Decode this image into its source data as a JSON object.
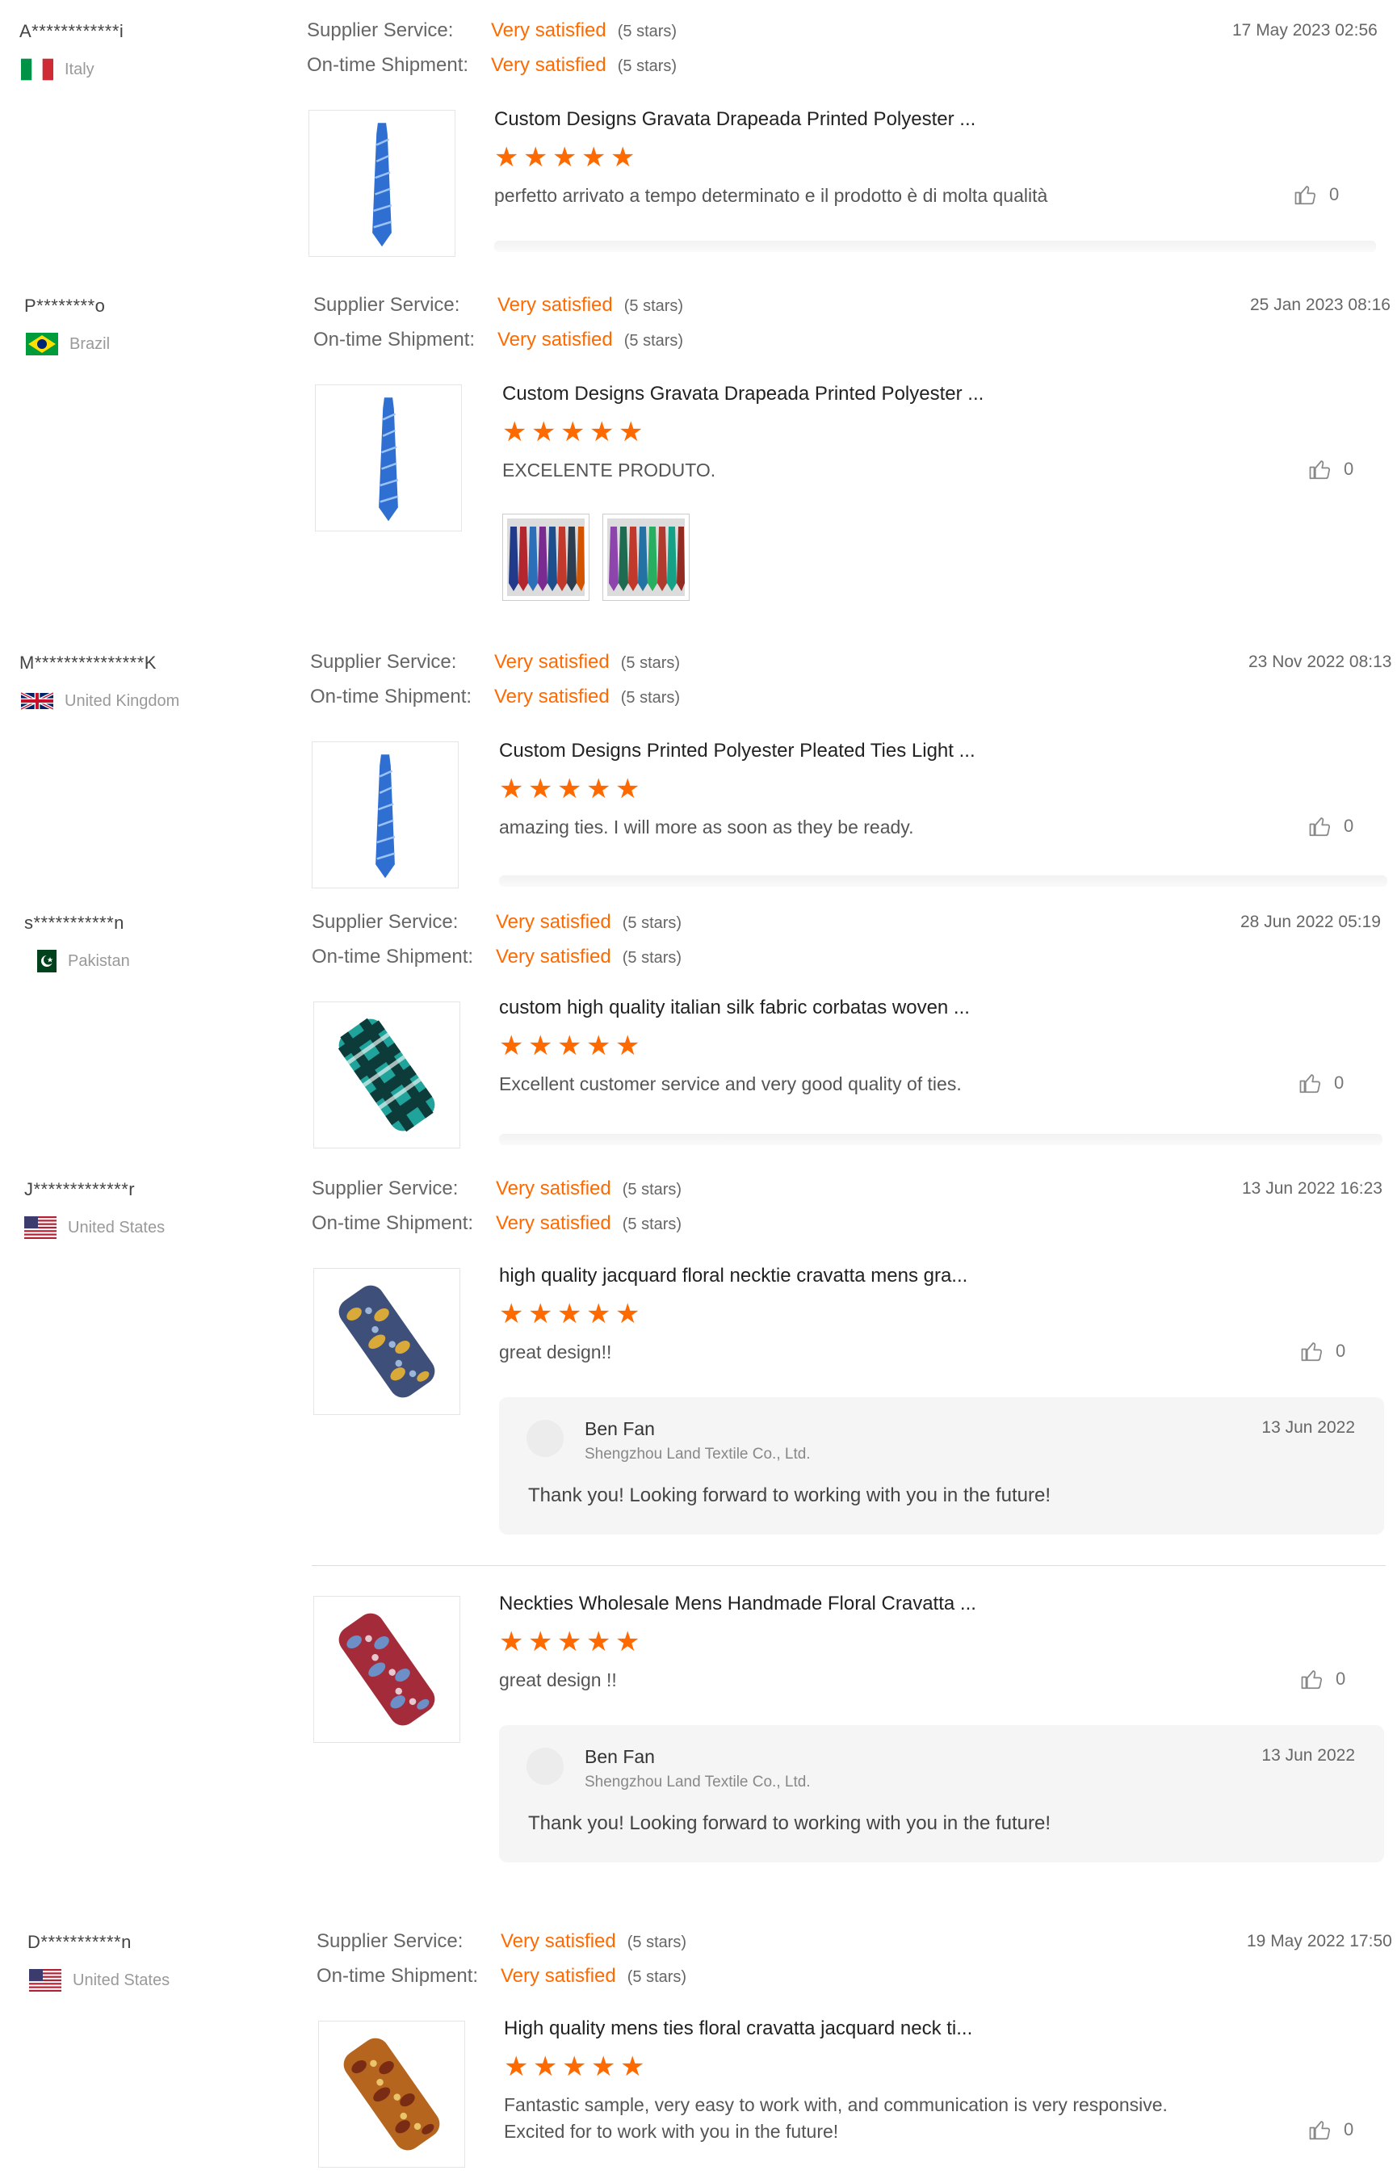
{
  "labels": {
    "supplier_service": "Supplier Service:",
    "ontime_shipment": "On-time Shipment:",
    "rating_value": "Very satisfied",
    "rating_note": "(5 stars)"
  },
  "reviews": [
    {
      "buyer": "A************i",
      "country": "Italy",
      "date": "17 May 2023 02:56",
      "products": [
        {
          "title": "Custom Designs Gravata Drapeada Printed Polyester ...",
          "rating": 5,
          "comment": "perfetto arrivato a tempo determinato e il prodotto è di molta qualità",
          "likes": "0",
          "image": "blue-striped-tie"
        }
      ]
    },
    {
      "buyer": "P********o",
      "country": "Brazil",
      "date": "25 Jan 2023 08:16",
      "products": [
        {
          "title": "Custom Designs Gravata Drapeada Printed Polyester ...",
          "rating": 5,
          "comment": "EXCELENTE PRODUTO.",
          "likes": "0",
          "image": "blue-striped-tie",
          "photos": [
            "ties-photo-1",
            "ties-photo-2"
          ]
        }
      ]
    },
    {
      "buyer": "M***************K",
      "country": "United Kingdom",
      "date": "23 Nov 2022 08:13",
      "products": [
        {
          "title": "Custom Designs Printed Polyester Pleated Ties Light ...",
          "rating": 5,
          "comment": "amazing ties. I will more as soon as they be ready.",
          "likes": "0",
          "image": "blue-striped-tie"
        }
      ]
    },
    {
      "buyer": "s***********n",
      "country": "Pakistan",
      "date": "28 Jun 2022 05:19",
      "products": [
        {
          "title": "custom high quality italian silk fabric corbatas woven ...",
          "rating": 5,
          "comment": "Excellent customer service and very good quality of ties.",
          "likes": "0",
          "image": "teal-plaid-tie"
        }
      ]
    },
    {
      "buyer": "J*************r",
      "country": "United States",
      "date": "13 Jun 2022 16:23",
      "products": [
        {
          "title": "high quality jacquard floral necktie cravatta mens gra...",
          "rating": 5,
          "comment": "great design!!",
          "likes": "0",
          "image": "paisley-blue-gold-tie",
          "reply": {
            "name": "Ben Fan",
            "company": "Shengzhou Land Textile Co., Ltd.",
            "date": "13 Jun 2022",
            "text": "Thank you! Looking forward to working with you in the future!"
          }
        },
        {
          "title": "Neckties Wholesale Mens Handmade Floral Cravatta ...",
          "rating": 5,
          "comment": "great design !!",
          "likes": "0",
          "image": "paisley-red-tie",
          "reply": {
            "name": "Ben Fan",
            "company": "Shengzhou Land Textile Co., Ltd.",
            "date": "13 Jun 2022",
            "text": "Thank you! Looking forward to working with you in the future!"
          }
        }
      ]
    },
    {
      "buyer": "D***********n",
      "country": "United States",
      "date": "19 May 2022 17:50",
      "products": [
        {
          "title": "High quality mens ties floral cravatta jacquard neck ti...",
          "rating": 5,
          "comment_line1": "Fantastic sample, very easy to work with, and communication is very responsive.",
          "comment_line2": "Excited for to work with you in the future!",
          "likes": "0",
          "image": "paisley-orange-tie"
        }
      ]
    }
  ],
  "colors": {
    "accent": "#ff6a00",
    "muted": "#999999"
  }
}
